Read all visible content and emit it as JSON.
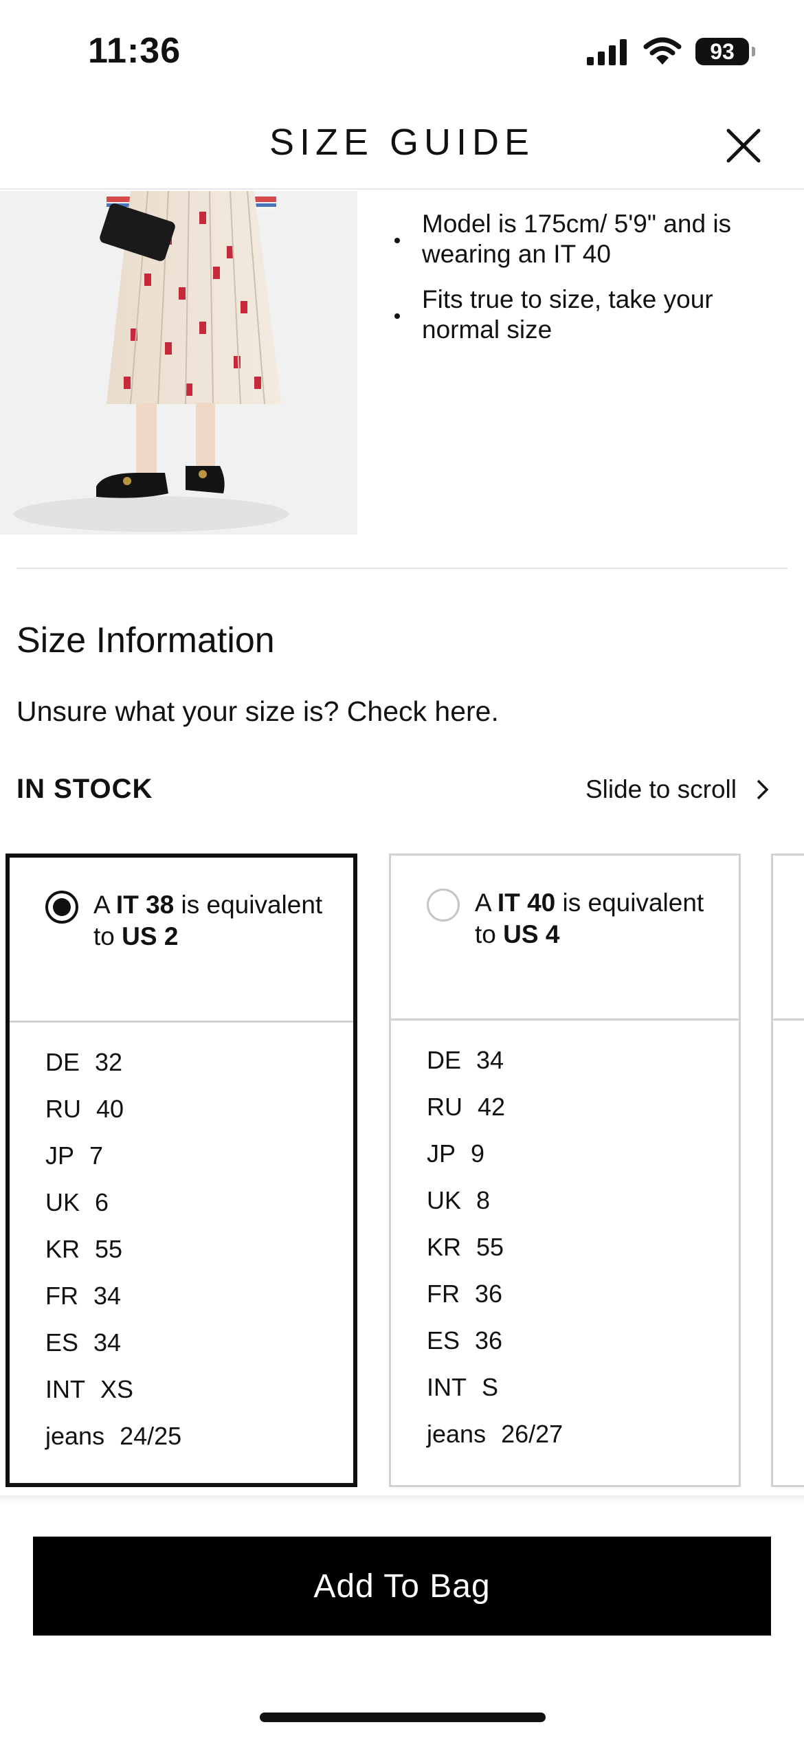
{
  "status_bar": {
    "time": "11:36",
    "battery": "93"
  },
  "header": {
    "title": "SIZE GUIDE",
    "close_icon": "close-icon"
  },
  "product": {
    "image_alt": "model-wearing-pleated-printed-skirt-icon",
    "notes": [
      "Model is 175cm/ 5'9\" and is wearing an IT 40",
      "Fits true to size, take your normal size"
    ]
  },
  "size_info": {
    "heading": "Size Information",
    "unsure_text": "Unsure what your size is? Check here.",
    "stock_label": "IN STOCK",
    "slide_hint": "Slide to scroll"
  },
  "size_cards": [
    {
      "selected": true,
      "prefix": "A ",
      "size": "IT 38",
      "middle": " is equivalent to ",
      "us": "US 2",
      "conversions": [
        {
          "k": "DE",
          "v": "32"
        },
        {
          "k": "RU",
          "v": "40"
        },
        {
          "k": "JP",
          "v": "7"
        },
        {
          "k": "UK",
          "v": "6"
        },
        {
          "k": "KR",
          "v": "55"
        },
        {
          "k": "FR",
          "v": "34"
        },
        {
          "k": "ES",
          "v": "34"
        },
        {
          "k": "INT",
          "v": "XS"
        },
        {
          "k": "jeans",
          "v": "24/25"
        }
      ]
    },
    {
      "selected": false,
      "prefix": "A ",
      "size": "IT 40",
      "middle": " is equivalent to ",
      "us": "US 4",
      "conversions": [
        {
          "k": "DE",
          "v": "34"
        },
        {
          "k": "RU",
          "v": "42"
        },
        {
          "k": "JP",
          "v": "9"
        },
        {
          "k": "UK",
          "v": "8"
        },
        {
          "k": "KR",
          "v": "55"
        },
        {
          "k": "FR",
          "v": "36"
        },
        {
          "k": "ES",
          "v": "36"
        },
        {
          "k": "INT",
          "v": "S"
        },
        {
          "k": "jeans",
          "v": "26/27"
        }
      ]
    }
  ],
  "actions": {
    "add_to_bag": "Add To Bag"
  },
  "colors": {
    "primary": "#000000",
    "border": "#d2d2d2",
    "divider": "#e5e5e5"
  }
}
